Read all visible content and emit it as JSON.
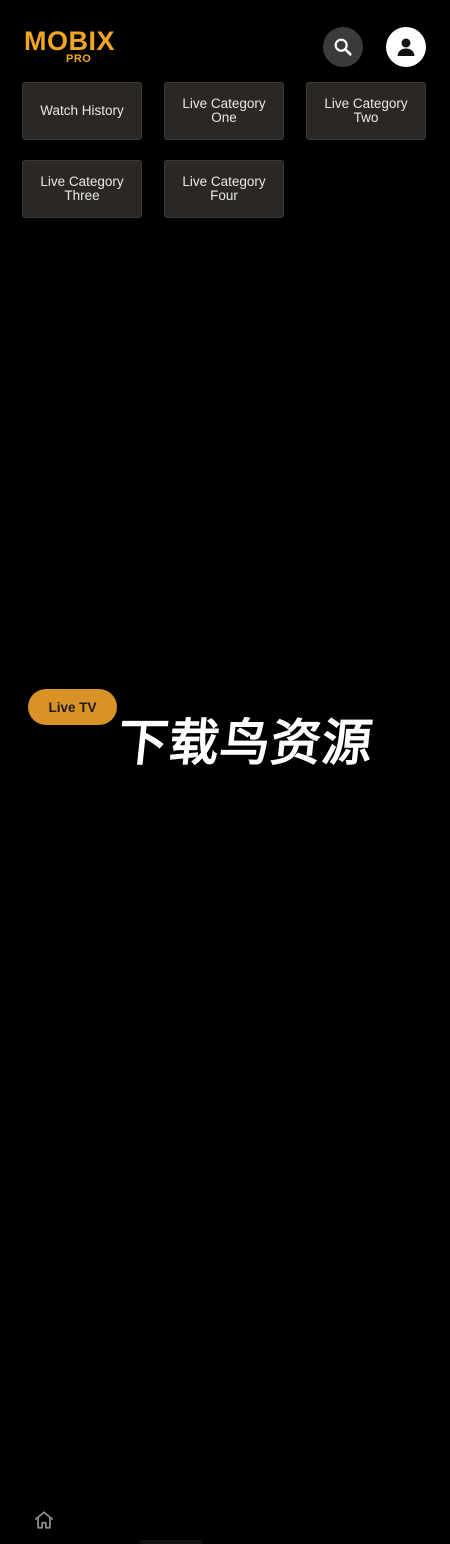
{
  "header": {
    "logo_main": "MOBIX",
    "logo_sub": "PRO",
    "logo_color": "#f0a623",
    "search_icon": "search-icon",
    "profile_icon": "user-icon"
  },
  "categories": [
    {
      "label": "Watch History"
    },
    {
      "label": "Live Category One"
    },
    {
      "label": "Live Category Two"
    },
    {
      "label": "Live Category Three"
    },
    {
      "label": "Live Category Four"
    }
  ],
  "floating_button": {
    "label": "Live TV",
    "color": "#d99226"
  },
  "watermark": {
    "text": "下载鸟资源"
  },
  "bottom_nav": {
    "home_icon": "home-icon"
  }
}
